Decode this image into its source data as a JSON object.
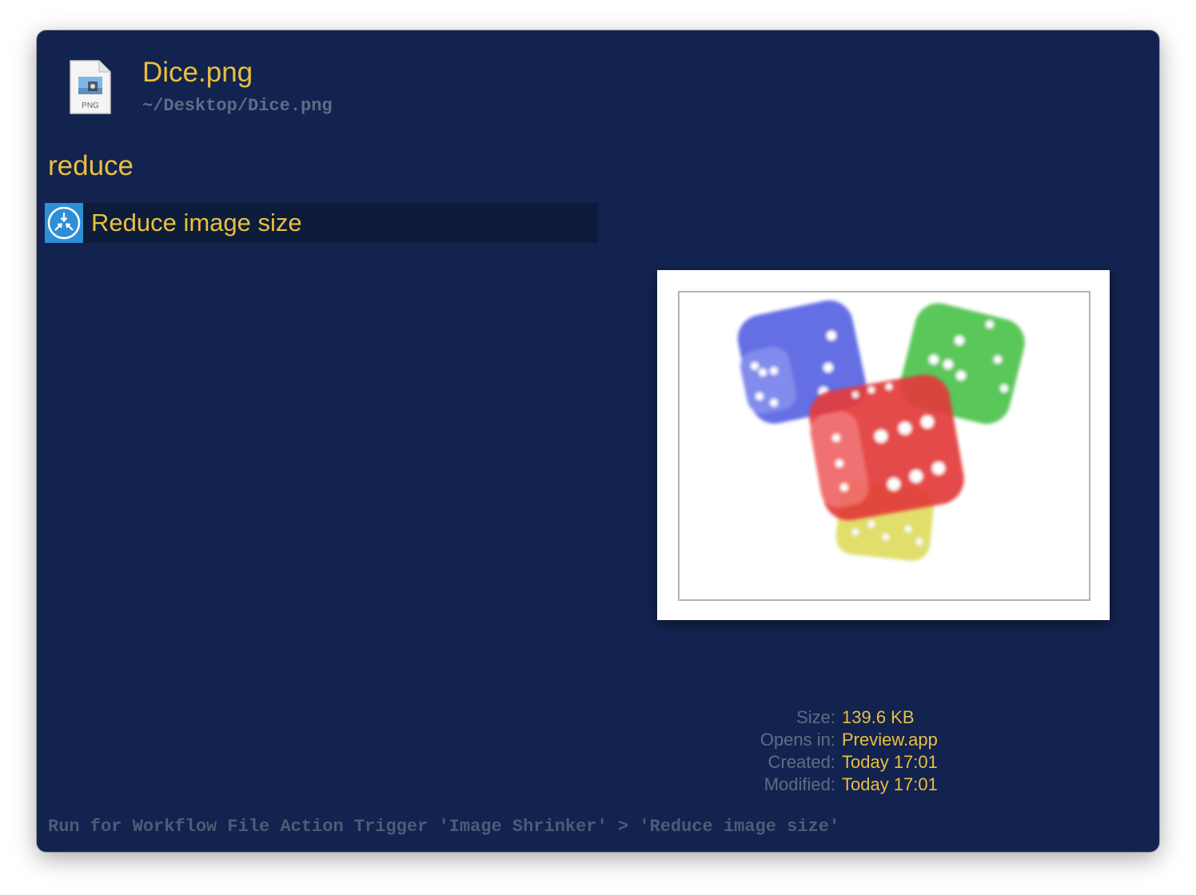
{
  "file": {
    "name": "Dice.png",
    "path": "~/Desktop/Dice.png",
    "icon": "png-file-icon",
    "icon_badge": "PNG"
  },
  "query": "reduce",
  "results": [
    {
      "label": "Reduce image size",
      "icon": "compress-arrows-icon"
    }
  ],
  "preview": {
    "image": "dice-image",
    "dice_colors": [
      "#4a57e0",
      "#3fbf3f",
      "#e23838",
      "#d8d43a"
    ]
  },
  "metadata": [
    {
      "key": "Size:",
      "value": "139.6 KB"
    },
    {
      "key": "Opens in:",
      "value": "Preview.app"
    },
    {
      "key": "Created:",
      "value": "Today 17:01"
    },
    {
      "key": "Modified:",
      "value": "Today 17:01"
    }
  ],
  "footer": "Run for Workflow File Action Trigger 'Image Shrinker' > 'Reduce image size'",
  "colors": {
    "background": "#12234f",
    "accent": "#e9bf3d",
    "muted": "#5b6e86",
    "selection": "#0c1c3a"
  }
}
